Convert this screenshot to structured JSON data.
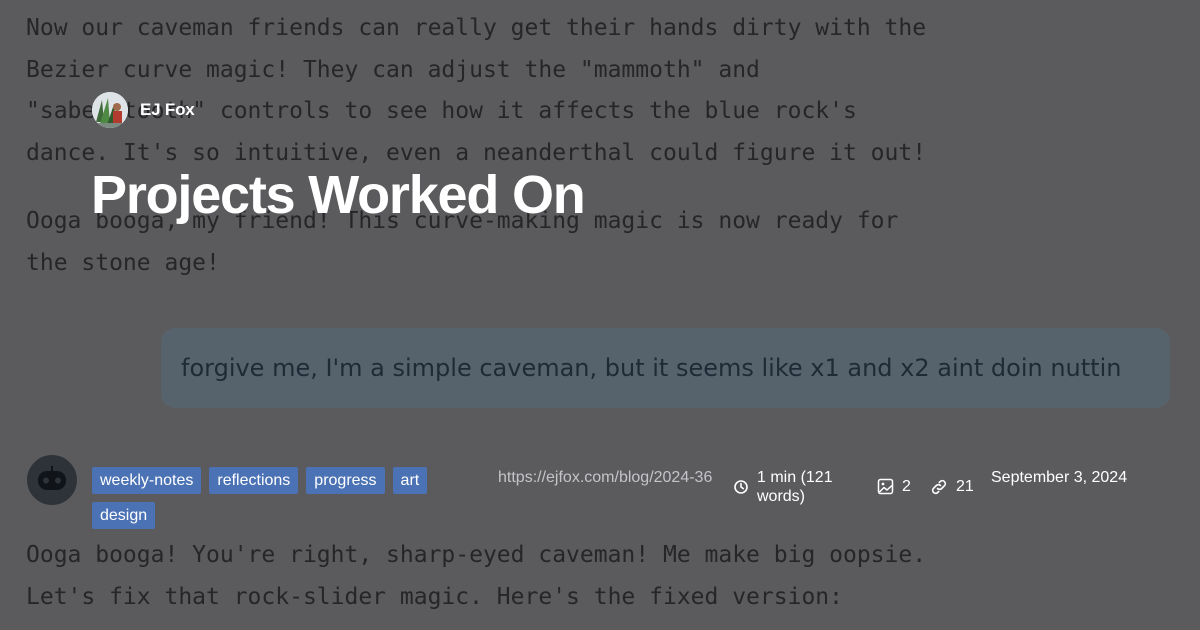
{
  "author": {
    "name": "EJ Fox",
    "avatar_icon": "author-avatar-image"
  },
  "title": "Projects Worked On",
  "background": {
    "paragraph_1": "Now our caveman friends can really get their hands dirty with the\nBezier curve magic! They can adjust the \"mammoth\" and\n\"saber-tooth\" controls to see how it affects the blue rock's\ndance. It's so intuitive, even a neanderthal could figure it out!",
    "paragraph_2": "Ooga booga, my friend! This curve-making magic is now ready for\nthe stone age!",
    "user_message": "forgive me, I'm a simple caveman, but it seems like x1 and x2 aint doin nuttin",
    "paragraph_3": "Ooga booga! You're right, sharp-eyed caveman! Me make big oopsie.\nLet's fix that rock-slider magic. Here's the fixed version:",
    "assistant_avatar_icon": "robot-icon"
  },
  "tags": [
    "weekly-notes",
    "reflections",
    "progress",
    "art",
    "design"
  ],
  "meta": {
    "url": "https://ejfox.com/blog/2024-36",
    "read_time": "1 min (121 words)",
    "images_count": "2",
    "links_count": "21",
    "date": "September 3, 2024"
  },
  "colors": {
    "background": "#5b5b5e",
    "tag_background": "#4b72b4",
    "user_bubble": "#57636c",
    "title_text": "#ffffff"
  },
  "icons": {
    "read_time": "clock-icon",
    "images": "image-icon",
    "links": "link-icon"
  }
}
